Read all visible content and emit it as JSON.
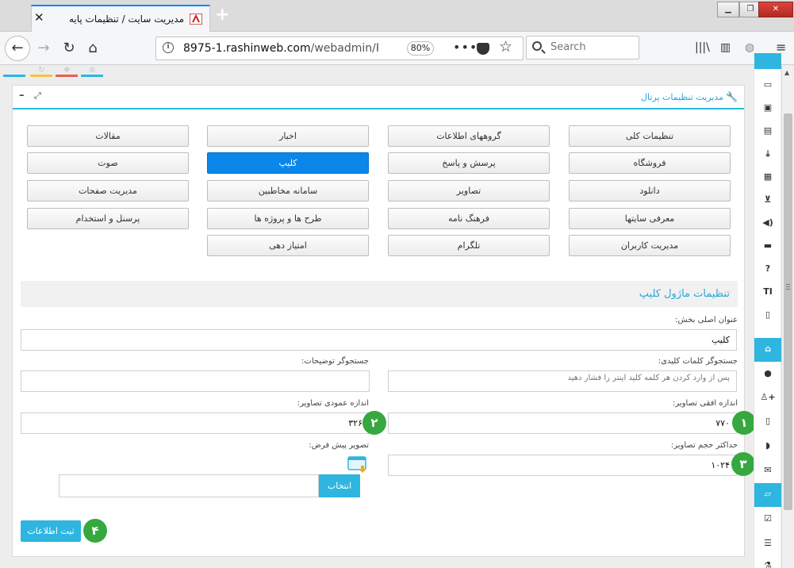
{
  "browser": {
    "tab_title": "مدیریت سایت / تنظیمات پایه",
    "tab_close": "✕",
    "new_tab": "+",
    "url_host": "8975-1.rashinweb.com",
    "url_path": "/webadmin/Porta",
    "zoom": "80%",
    "search_placeholder": "Search",
    "window_minimize": "▁",
    "window_restore": "❐",
    "window_close": "✕"
  },
  "panel": {
    "title": "مدیریت تنظیمات پرتال",
    "minimize": "–",
    "expand": "⤢"
  },
  "modules": [
    "تنظیمات کلی",
    "گروههای اطلاعات",
    "اخبار",
    "مقالات",
    "فروشگاه",
    "پرسش و پاسخ",
    "کلیپ",
    "صوت",
    "دانلود",
    "تصاویر",
    "سامانه مخاطبین",
    "مدیریت صفحات",
    "معرفی سایتها",
    "فرهنگ نامه",
    "طرح ها و پروژه ها",
    "پرسنل و استخدام",
    "مدیریت کاربران",
    "تلگرام",
    "امتیاز دهی"
  ],
  "active_module": "کلیپ",
  "form": {
    "section_title": "تنظیمات ماژول کلیپ",
    "main_title_label": "عنوان اصلی بخش:",
    "main_title_value": "کلیپ",
    "keyword_search_label": "جستجوگر کلمات کلیدی:",
    "keyword_search_placeholder": "پس از وارد کردن هر کلمه کلید اینتر را فشار دهید",
    "desc_search_label": "جستجوگر توضیحات:",
    "desc_search_value": "",
    "img_width_label": "اندازه افقی تصاویر:",
    "img_width_value": "۷۷۰",
    "img_height_label": "اندازه عمودی تصاویر:",
    "img_height_value": "۳۲۶",
    "max_size_label": "حداکثر حجم تصاویر:",
    "max_size_value": "۱۰۲۴",
    "default_img_label": "تصویر پیش فرض:",
    "choose_button": "انتخاب",
    "default_img_value": "",
    "submit_button": "ثبت اطلاعات"
  },
  "badges": [
    "۱",
    "۲",
    "۳",
    "۴"
  ],
  "colors": {
    "accent": "#29b8e0",
    "active_button": "#0b86ea",
    "badge": "#36a83f"
  },
  "sidebar_icons": [
    "id-card-icon",
    "image-icon",
    "document-icon",
    "download-icon",
    "film-icon",
    "cart-icon",
    "volume-icon",
    "monitor-icon",
    "question-icon",
    "text-size-icon",
    "page-icon",
    "inbox-icon",
    "user-icon",
    "user-plus-icon",
    "mobile-icon",
    "comments-icon",
    "envelope-icon",
    "folder-open-icon",
    "checkbox-icon",
    "list-icon",
    "flask-icon"
  ]
}
